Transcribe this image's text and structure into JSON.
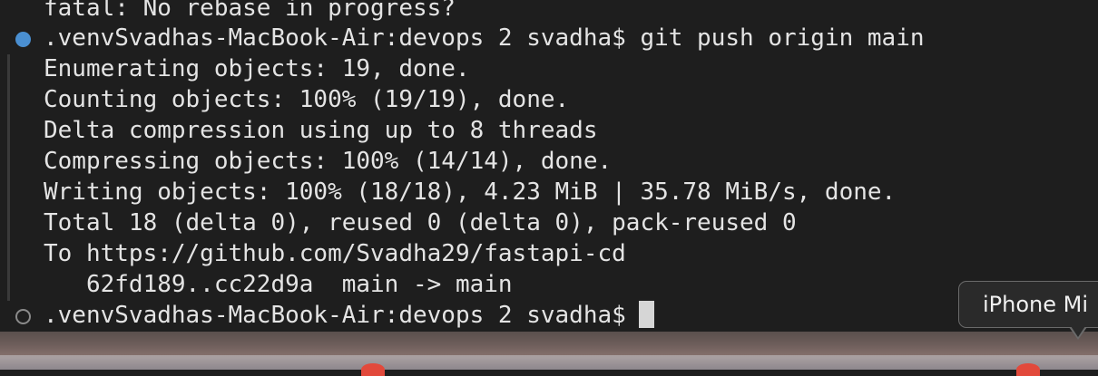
{
  "terminal": {
    "lines": [
      "fatal: No rebase in progress?",
      ".venvSvadhas-MacBook-Air:devops 2 svadha$ git push origin main",
      "Enumerating objects: 19, done.",
      "Counting objects: 100% (19/19), done.",
      "Delta compression using up to 8 threads",
      "Compressing objects: 100% (14/14), done.",
      "Writing objects: 100% (18/18), 4.23 MiB | 35.78 MiB/s, done.",
      "Total 18 (delta 0), reused 0 (delta 0), pack-reused 0",
      "To https://github.com/Svadha29/fastapi-cd",
      "   62fd189..cc22d9a  main -> main",
      ".venvSvadhas-MacBook-Air:devops 2 svadha$"
    ],
    "marker_color_success": "#4a8fd1",
    "marker_color_pending": "#8a8a8a"
  },
  "tooltip": {
    "label": "iPhone Mi"
  },
  "dock": {
    "indicator_color": "#e2493b"
  }
}
